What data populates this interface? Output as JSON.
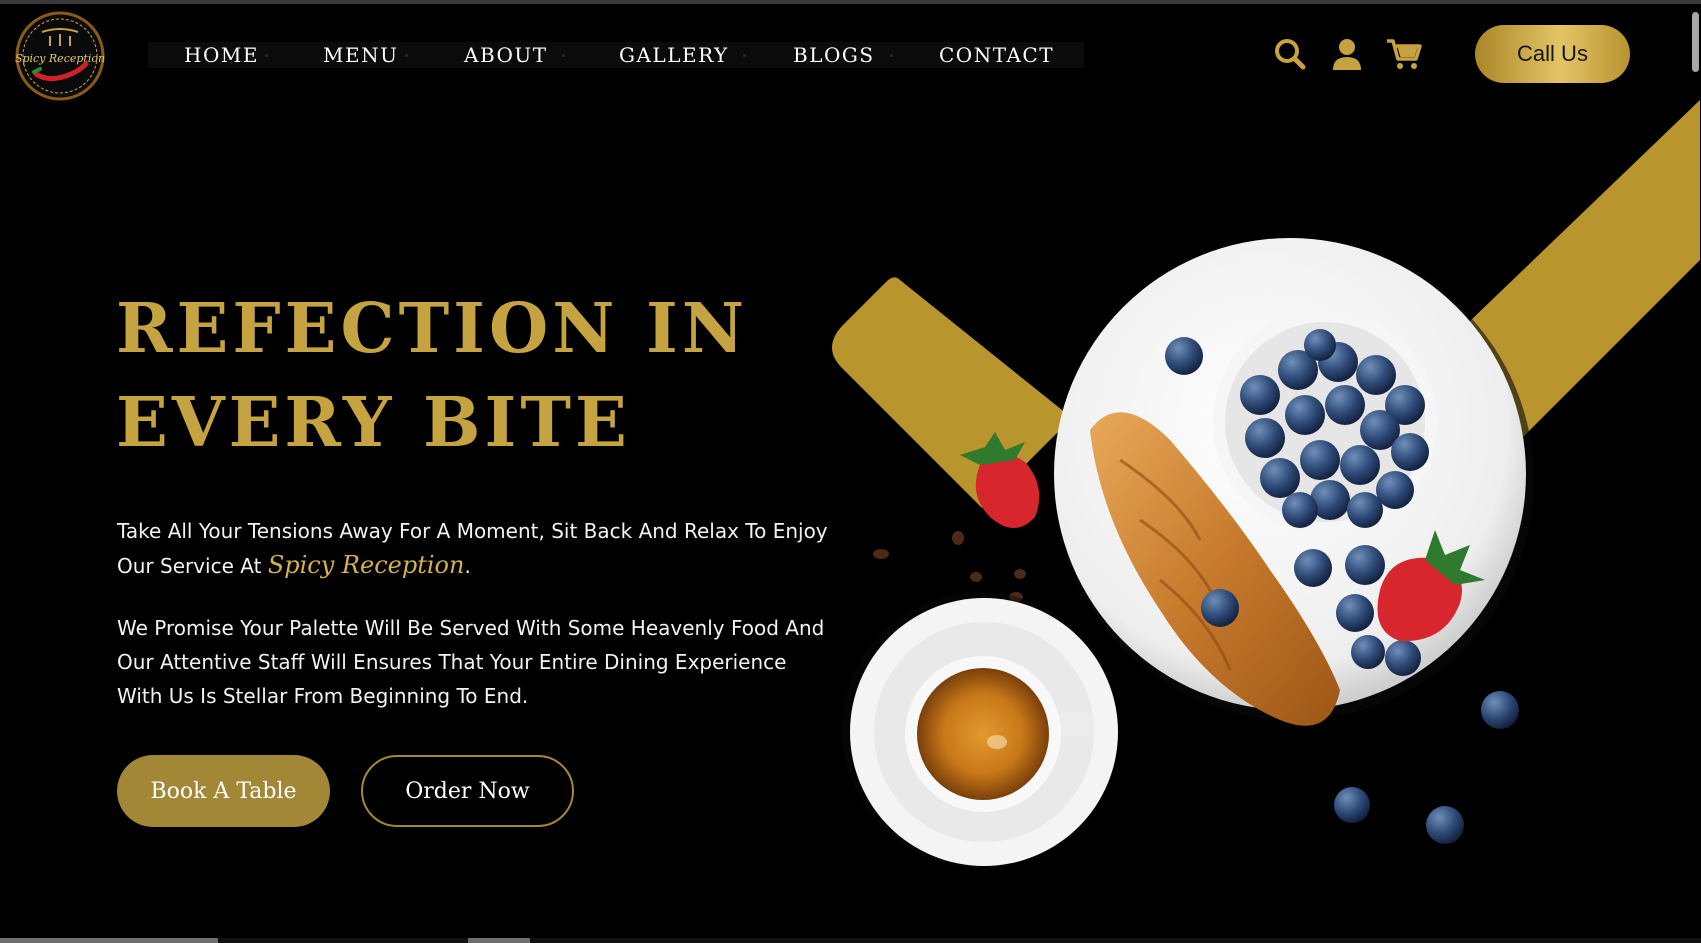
{
  "brand": {
    "logo_text": "Spicy Reception",
    "logo_icon": "restaurant-logo-icon"
  },
  "nav": {
    "items": [
      {
        "label": "HOME"
      },
      {
        "label": "MENU"
      },
      {
        "label": "ABOUT"
      },
      {
        "label": "GALLERY"
      },
      {
        "label": "BLOGS"
      },
      {
        "label": "CONTACT"
      }
    ]
  },
  "header": {
    "icons": [
      "search-icon",
      "user-icon",
      "cart-icon"
    ],
    "call_label": "Call Us"
  },
  "hero": {
    "title_line1": "REFECTION IN",
    "title_line2": "EVERY BITE",
    "para1_before": "Take All Your Tensions Away For A Moment, Sit Back And Relax To Enjoy Our Service At ",
    "para1_brand": "Spicy Reception",
    "para1_after": ".",
    "para2": "We Promise Your Palette Will Be Served With Some Heavenly Food And Our Attentive Staff Will Ensures That Your Entire Dining Experience With Us Is Stellar From Beginning To End.",
    "book_label": "Book A Table",
    "order_label": "Order Now"
  },
  "colors": {
    "accent_gold": "#c6a341",
    "button_gold": "#a28836",
    "background": "#000000"
  }
}
